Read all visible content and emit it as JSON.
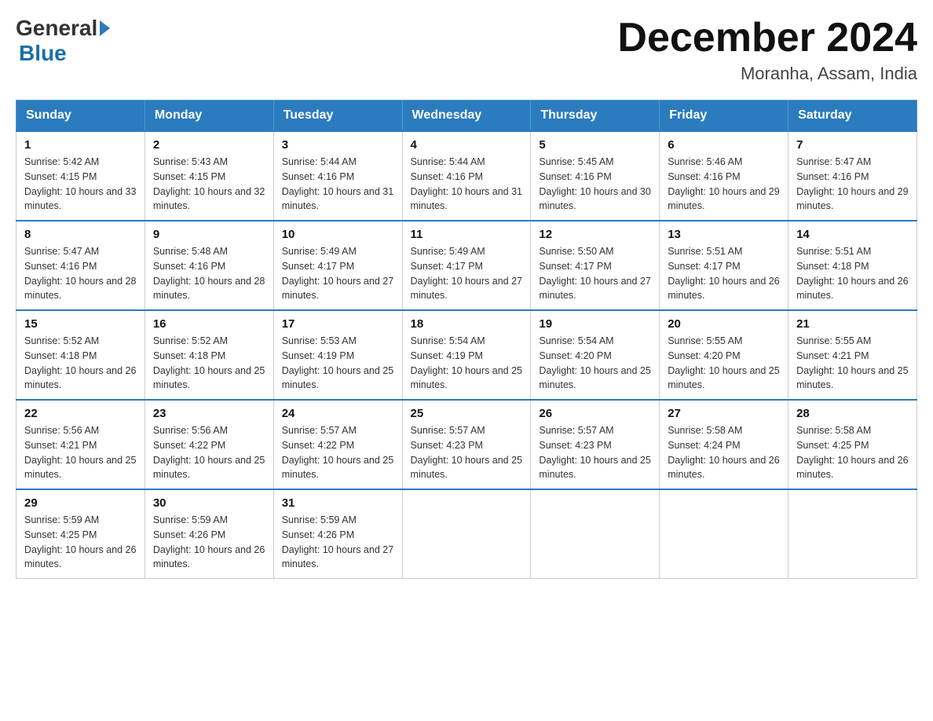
{
  "header": {
    "logo_general": "General",
    "logo_blue": "Blue",
    "month_year": "December 2024",
    "location": "Moranha, Assam, India"
  },
  "days_of_week": [
    "Sunday",
    "Monday",
    "Tuesday",
    "Wednesday",
    "Thursday",
    "Friday",
    "Saturday"
  ],
  "weeks": [
    [
      {
        "day": "1",
        "sunrise": "5:42 AM",
        "sunset": "4:15 PM",
        "daylight": "10 hours and 33 minutes."
      },
      {
        "day": "2",
        "sunrise": "5:43 AM",
        "sunset": "4:15 PM",
        "daylight": "10 hours and 32 minutes."
      },
      {
        "day": "3",
        "sunrise": "5:44 AM",
        "sunset": "4:16 PM",
        "daylight": "10 hours and 31 minutes."
      },
      {
        "day": "4",
        "sunrise": "5:44 AM",
        "sunset": "4:16 PM",
        "daylight": "10 hours and 31 minutes."
      },
      {
        "day": "5",
        "sunrise": "5:45 AM",
        "sunset": "4:16 PM",
        "daylight": "10 hours and 30 minutes."
      },
      {
        "day": "6",
        "sunrise": "5:46 AM",
        "sunset": "4:16 PM",
        "daylight": "10 hours and 29 minutes."
      },
      {
        "day": "7",
        "sunrise": "5:47 AM",
        "sunset": "4:16 PM",
        "daylight": "10 hours and 29 minutes."
      }
    ],
    [
      {
        "day": "8",
        "sunrise": "5:47 AM",
        "sunset": "4:16 PM",
        "daylight": "10 hours and 28 minutes."
      },
      {
        "day": "9",
        "sunrise": "5:48 AM",
        "sunset": "4:16 PM",
        "daylight": "10 hours and 28 minutes."
      },
      {
        "day": "10",
        "sunrise": "5:49 AM",
        "sunset": "4:17 PM",
        "daylight": "10 hours and 27 minutes."
      },
      {
        "day": "11",
        "sunrise": "5:49 AM",
        "sunset": "4:17 PM",
        "daylight": "10 hours and 27 minutes."
      },
      {
        "day": "12",
        "sunrise": "5:50 AM",
        "sunset": "4:17 PM",
        "daylight": "10 hours and 27 minutes."
      },
      {
        "day": "13",
        "sunrise": "5:51 AM",
        "sunset": "4:17 PM",
        "daylight": "10 hours and 26 minutes."
      },
      {
        "day": "14",
        "sunrise": "5:51 AM",
        "sunset": "4:18 PM",
        "daylight": "10 hours and 26 minutes."
      }
    ],
    [
      {
        "day": "15",
        "sunrise": "5:52 AM",
        "sunset": "4:18 PM",
        "daylight": "10 hours and 26 minutes."
      },
      {
        "day": "16",
        "sunrise": "5:52 AM",
        "sunset": "4:18 PM",
        "daylight": "10 hours and 25 minutes."
      },
      {
        "day": "17",
        "sunrise": "5:53 AM",
        "sunset": "4:19 PM",
        "daylight": "10 hours and 25 minutes."
      },
      {
        "day": "18",
        "sunrise": "5:54 AM",
        "sunset": "4:19 PM",
        "daylight": "10 hours and 25 minutes."
      },
      {
        "day": "19",
        "sunrise": "5:54 AM",
        "sunset": "4:20 PM",
        "daylight": "10 hours and 25 minutes."
      },
      {
        "day": "20",
        "sunrise": "5:55 AM",
        "sunset": "4:20 PM",
        "daylight": "10 hours and 25 minutes."
      },
      {
        "day": "21",
        "sunrise": "5:55 AM",
        "sunset": "4:21 PM",
        "daylight": "10 hours and 25 minutes."
      }
    ],
    [
      {
        "day": "22",
        "sunrise": "5:56 AM",
        "sunset": "4:21 PM",
        "daylight": "10 hours and 25 minutes."
      },
      {
        "day": "23",
        "sunrise": "5:56 AM",
        "sunset": "4:22 PM",
        "daylight": "10 hours and 25 minutes."
      },
      {
        "day": "24",
        "sunrise": "5:57 AM",
        "sunset": "4:22 PM",
        "daylight": "10 hours and 25 minutes."
      },
      {
        "day": "25",
        "sunrise": "5:57 AM",
        "sunset": "4:23 PM",
        "daylight": "10 hours and 25 minutes."
      },
      {
        "day": "26",
        "sunrise": "5:57 AM",
        "sunset": "4:23 PM",
        "daylight": "10 hours and 25 minutes."
      },
      {
        "day": "27",
        "sunrise": "5:58 AM",
        "sunset": "4:24 PM",
        "daylight": "10 hours and 26 minutes."
      },
      {
        "day": "28",
        "sunrise": "5:58 AM",
        "sunset": "4:25 PM",
        "daylight": "10 hours and 26 minutes."
      }
    ],
    [
      {
        "day": "29",
        "sunrise": "5:59 AM",
        "sunset": "4:25 PM",
        "daylight": "10 hours and 26 minutes."
      },
      {
        "day": "30",
        "sunrise": "5:59 AM",
        "sunset": "4:26 PM",
        "daylight": "10 hours and 26 minutes."
      },
      {
        "day": "31",
        "sunrise": "5:59 AM",
        "sunset": "4:26 PM",
        "daylight": "10 hours and 27 minutes."
      },
      null,
      null,
      null,
      null
    ]
  ]
}
